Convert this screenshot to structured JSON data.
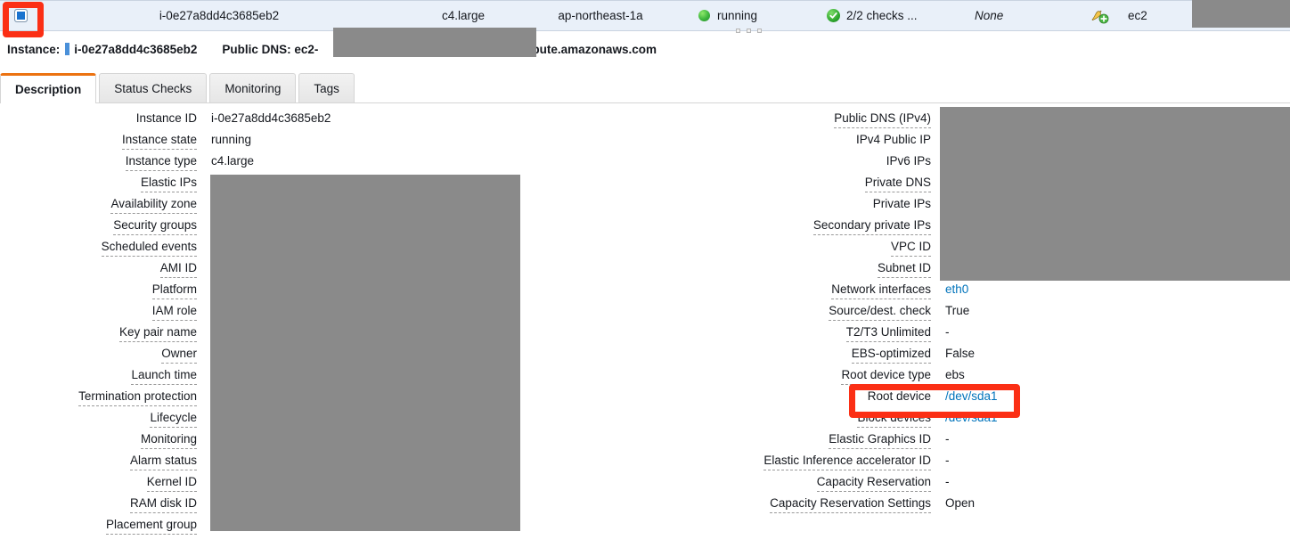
{
  "grid_row": {
    "checkbox_checked": true,
    "instance_id": "i-0e27a8dd4c3685eb2",
    "instance_type": "c4.large",
    "availability_zone": "ap-northeast-1a",
    "instance_state": "running",
    "status_checks": "2/2 checks ...",
    "alarm_status": "None",
    "key_name": "ec2",
    "state_icon": "green-circle-icon",
    "checks_icon": "green-check-icon",
    "alarm_icon": "bell-add-icon",
    "accent_green": "#2fa82f",
    "selected_row_bg": "#e9f0f9"
  },
  "summary": {
    "instance_label": "Instance:",
    "instance_id": "i-0e27a8dd4c3685eb2",
    "public_dns_label": "Public DNS: ec2-",
    "public_dns_suffix": "mpute.amazonaws.com"
  },
  "tabs": [
    {
      "label": "Description",
      "active": true
    },
    {
      "label": "Status Checks",
      "active": false
    },
    {
      "label": "Monitoring",
      "active": false
    },
    {
      "label": "Tags",
      "active": false
    }
  ],
  "left_details": [
    {
      "label": "Instance ID",
      "value": "i-0e27a8dd4c3685eb2",
      "underline": false,
      "link": false
    },
    {
      "label": "Instance state",
      "value": "running",
      "underline": true,
      "link": false
    },
    {
      "label": "Instance type",
      "value": "c4.large",
      "underline": true,
      "link": false
    },
    {
      "label": "Elastic IPs",
      "value": "",
      "underline": true,
      "link": false
    },
    {
      "label": "Availability zone",
      "value": "",
      "underline": true,
      "link": false
    },
    {
      "label": "Security groups",
      "value": "",
      "underline": true,
      "link": false
    },
    {
      "label": "Scheduled events",
      "value": "",
      "underline": true,
      "link": false
    },
    {
      "label": "AMI ID",
      "value": "",
      "underline": true,
      "link": false
    },
    {
      "label": "Platform",
      "value": "",
      "underline": true,
      "link": false
    },
    {
      "label": "IAM role",
      "value": "",
      "underline": true,
      "link": false
    },
    {
      "label": "Key pair name",
      "value": "",
      "underline": true,
      "link": false
    },
    {
      "label": "Owner",
      "value": "",
      "underline": true,
      "link": false
    },
    {
      "label": "Launch time",
      "value": "",
      "underline": true,
      "link": false
    },
    {
      "label": "Termination protection",
      "value": "",
      "underline": true,
      "link": false
    },
    {
      "label": "Lifecycle",
      "value": "",
      "underline": true,
      "link": false
    },
    {
      "label": "Monitoring",
      "value": "",
      "underline": true,
      "link": false
    },
    {
      "label": "Alarm status",
      "value": "",
      "underline": true,
      "link": false
    },
    {
      "label": "Kernel ID",
      "value": "",
      "underline": true,
      "link": false
    },
    {
      "label": "RAM disk ID",
      "value": "",
      "underline": true,
      "link": false
    },
    {
      "label": "Placement group",
      "value": "",
      "underline": true,
      "link": false
    }
  ],
  "right_details": [
    {
      "label": "Public DNS (IPv4)",
      "value": "",
      "underline": true,
      "link": false
    },
    {
      "label": "IPv4 Public IP",
      "value": "",
      "underline": false,
      "link": false
    },
    {
      "label": "IPv6 IPs",
      "value": "",
      "underline": false,
      "link": false
    },
    {
      "label": "Private DNS",
      "value": "",
      "underline": true,
      "link": false
    },
    {
      "label": "Private IPs",
      "value": "",
      "underline": false,
      "link": false
    },
    {
      "label": "Secondary private IPs",
      "value": "",
      "underline": true,
      "link": false
    },
    {
      "label": "VPC ID",
      "value": "",
      "underline": true,
      "link": false
    },
    {
      "label": "Subnet ID",
      "value": "",
      "underline": true,
      "link": false
    },
    {
      "label": "Network interfaces",
      "value": "eth0",
      "underline": true,
      "link": true
    },
    {
      "label": "Source/dest. check",
      "value": "True",
      "underline": true,
      "link": false
    },
    {
      "label": "T2/T3 Unlimited",
      "value": "-",
      "underline": true,
      "link": false
    },
    {
      "label": "EBS-optimized",
      "value": "False",
      "underline": true,
      "link": false
    },
    {
      "label": "Root device type",
      "value": "ebs",
      "underline": true,
      "link": false
    },
    {
      "label": "Root device",
      "value": "/dev/sda1",
      "underline": false,
      "link": true
    },
    {
      "label": "Block devices",
      "value": "/dev/sda1",
      "underline": true,
      "link": true
    },
    {
      "label": "Elastic Graphics ID",
      "value": "-",
      "underline": true,
      "link": false
    },
    {
      "label": "Elastic Inference accelerator ID",
      "value": "-",
      "underline": true,
      "link": false
    },
    {
      "label": "Capacity Reservation",
      "value": "-",
      "underline": true,
      "link": false
    },
    {
      "label": "Capacity Reservation Settings",
      "value": "Open",
      "underline": true,
      "link": false
    }
  ],
  "annotations": {
    "color": "#fb2f15",
    "boxes": [
      {
        "name": "checkbox-highlight",
        "target": "row-checkbox"
      },
      {
        "name": "root-device-highlight",
        "target": "root-device-row"
      }
    ]
  }
}
